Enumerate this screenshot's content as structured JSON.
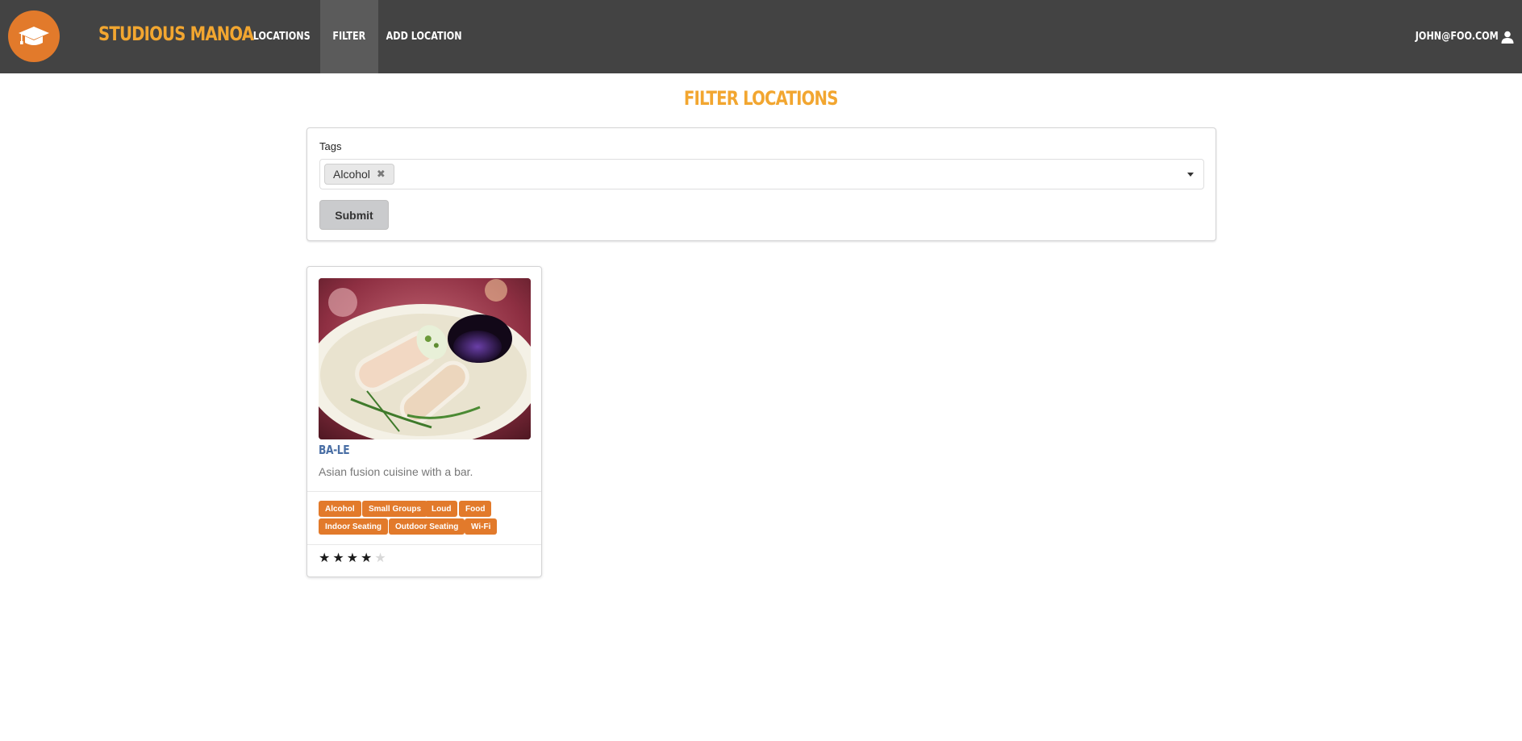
{
  "navbar": {
    "brand": "Studious Manoa",
    "logo_icon": "graduation-cap-icon",
    "items": [
      {
        "label": "Locations",
        "active": false
      },
      {
        "label": "Filter",
        "active": true
      },
      {
        "label": "Add Location",
        "active": false
      }
    ],
    "user": "john@foo.com",
    "user_icon": "user-icon"
  },
  "page": {
    "title": "Filter Locations"
  },
  "filter_form": {
    "tags_label": "Tags",
    "selected_tags": [
      "Alcohol"
    ],
    "submit_label": "Submit"
  },
  "cards": [
    {
      "name": "Ba-Le",
      "description": "Asian fusion cuisine with a bar.",
      "image_alt": "spring rolls with dipping sauce",
      "tags": [
        "Alcohol",
        "Small Groups",
        "Loud",
        "Food",
        "Indoor Seating",
        "Outdoor Seating",
        "Wi-Fi"
      ],
      "rating": 4,
      "rating_max": 5
    }
  ],
  "colors": {
    "navbar_bg": "#434343",
    "brand": "#f2a630",
    "accent_orange": "#e27a2b",
    "card_title": "#4a6fa5"
  }
}
